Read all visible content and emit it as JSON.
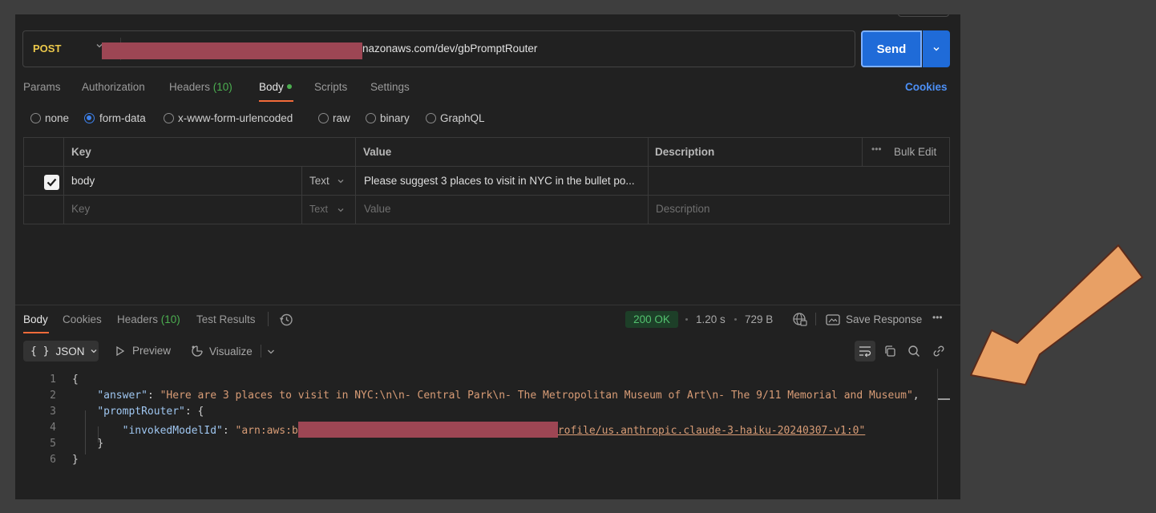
{
  "request": {
    "method": "POST",
    "url_visible": "nazonaws.com/dev/gbPromptRouter",
    "send_label": "Send",
    "tabs": [
      {
        "label": "Params"
      },
      {
        "label": "Authorization"
      },
      {
        "label": "Headers",
        "count": "(10)"
      },
      {
        "label": "Body"
      },
      {
        "label": "Scripts"
      },
      {
        "label": "Settings"
      }
    ],
    "cookies_label": "Cookies",
    "body_types": [
      "none",
      "form-data",
      "x-www-form-urlencoded",
      "raw",
      "binary",
      "GraphQL"
    ],
    "selected_body_type": "form-data",
    "table": {
      "headers": [
        "Key",
        "Value",
        "Description"
      ],
      "bulk_edit": "Bulk Edit",
      "rows": [
        {
          "checked": true,
          "key": "body",
          "type": "Text",
          "value": "Please suggest 3 places to visit in NYC in the bullet po...",
          "description": ""
        }
      ],
      "placeholders": {
        "key": "Key",
        "type": "Text",
        "value": "Value",
        "description": "Description"
      }
    }
  },
  "response": {
    "tabs": [
      {
        "label": "Body"
      },
      {
        "label": "Cookies"
      },
      {
        "label": "Headers",
        "count": "(10)"
      },
      {
        "label": "Test Results"
      }
    ],
    "status": "200 OK",
    "time": "1.20 s",
    "size": "729 B",
    "save_response": "Save Response",
    "format": "JSON",
    "format_icon": "{ }",
    "preview": "Preview",
    "visualize": "Visualize",
    "code_lines": [
      {
        "n": "1",
        "text": "{"
      },
      {
        "n": "2",
        "key": "\"answer\"",
        "value": "\"Here are 3 places to visit in NYC:\\n\\n- Central Park\\n- The Metropolitan Museum of Art\\n- The 9/11 Memorial and Museum\"",
        "tail": ","
      },
      {
        "n": "3",
        "key": "\"promptRouter\"",
        "tail": ": {"
      },
      {
        "n": "4",
        "key": "\"invokedModelId\"",
        "value_start": "\"arn:aws:b",
        "value_end": "rofile/us.anthropic.claude-3-haiku-20240307-v1:0\""
      },
      {
        "n": "5",
        "text": "}"
      },
      {
        "n": "6",
        "text": "}"
      }
    ]
  },
  "colors": {
    "accent": "#1f6bd8",
    "active_tab_underline": "#f26b3a",
    "status_ok": "#53c26f",
    "method_post": "#ecc94b",
    "redaction": "#9d4654",
    "annotation_arrow": "#e8a065"
  }
}
